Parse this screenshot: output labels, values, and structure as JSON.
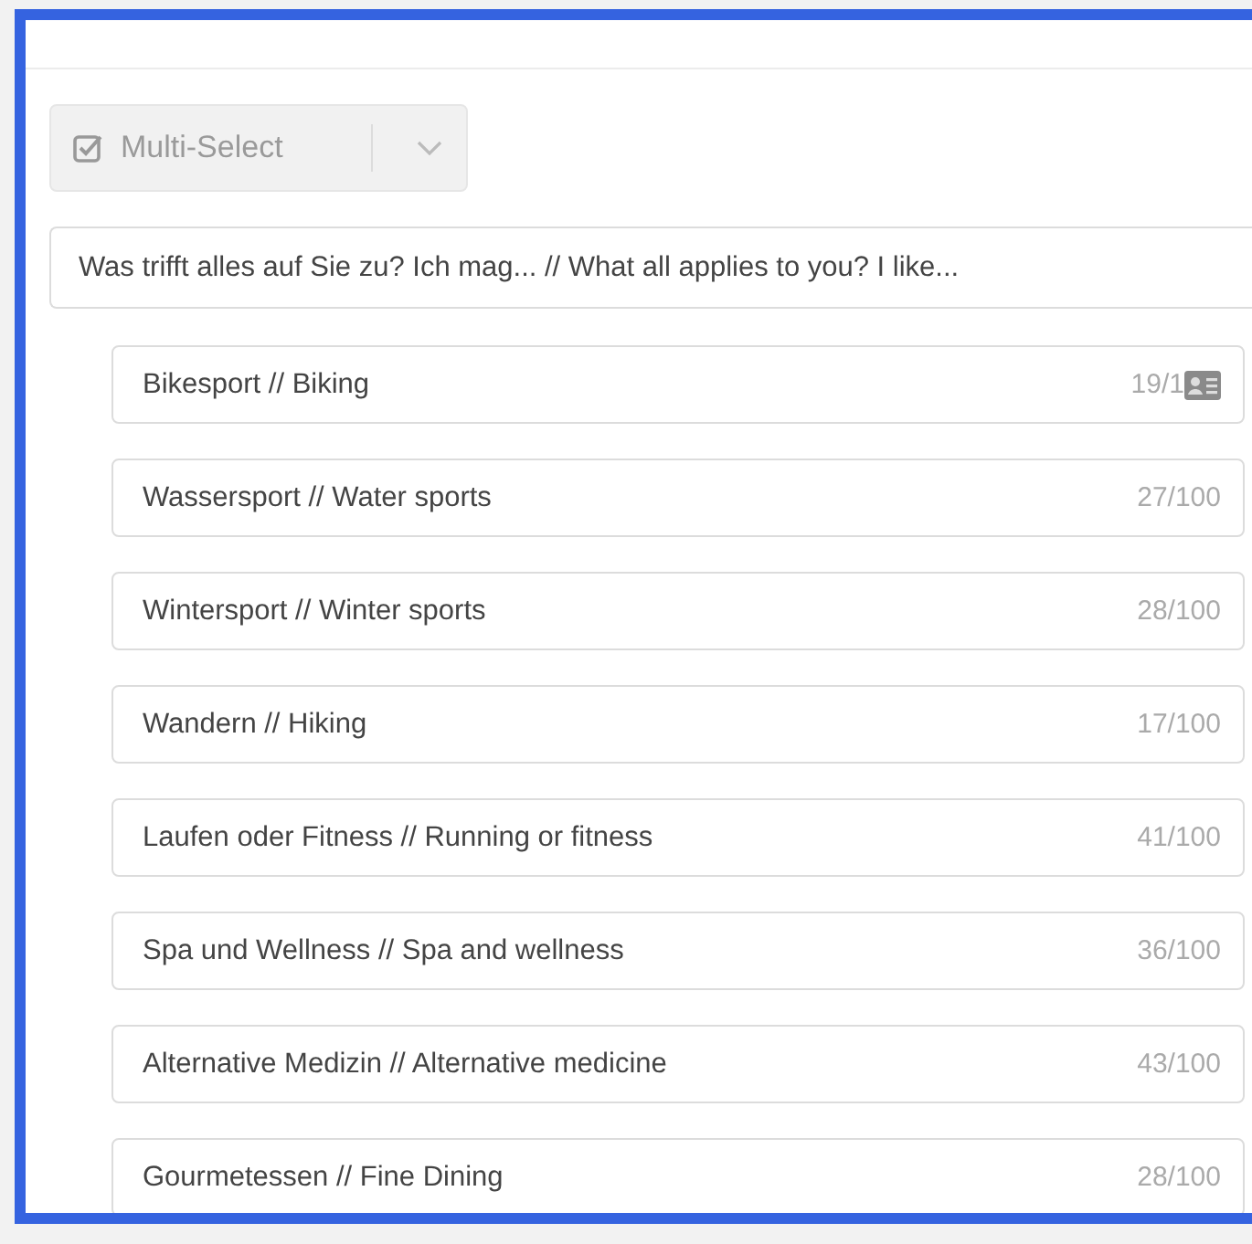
{
  "type_select": {
    "label": "Multi-Select",
    "checked": true
  },
  "question": "Was trifft alles auf Sie zu? Ich mag... // What all applies to you? I like...",
  "options": [
    {
      "label": "Bikesport // Biking",
      "count": "19/1",
      "covered": true
    },
    {
      "label": "Wassersport // Water sports",
      "count": "27/100",
      "covered": false
    },
    {
      "label": "Wintersport // Winter sports",
      "count": "28/100",
      "covered": false
    },
    {
      "label": "Wandern // Hiking",
      "count": "17/100",
      "covered": false
    },
    {
      "label": "Laufen oder Fitness // Running or fitness",
      "count": "41/100",
      "covered": false
    },
    {
      "label": "Spa und Wellness // Spa and wellness",
      "count": "36/100",
      "covered": false
    },
    {
      "label": "Alternative Medizin // Alternative medicine",
      "count": "43/100",
      "covered": false
    },
    {
      "label": "Gourmetessen // Fine Dining",
      "count": "28/100",
      "covered": false
    }
  ]
}
